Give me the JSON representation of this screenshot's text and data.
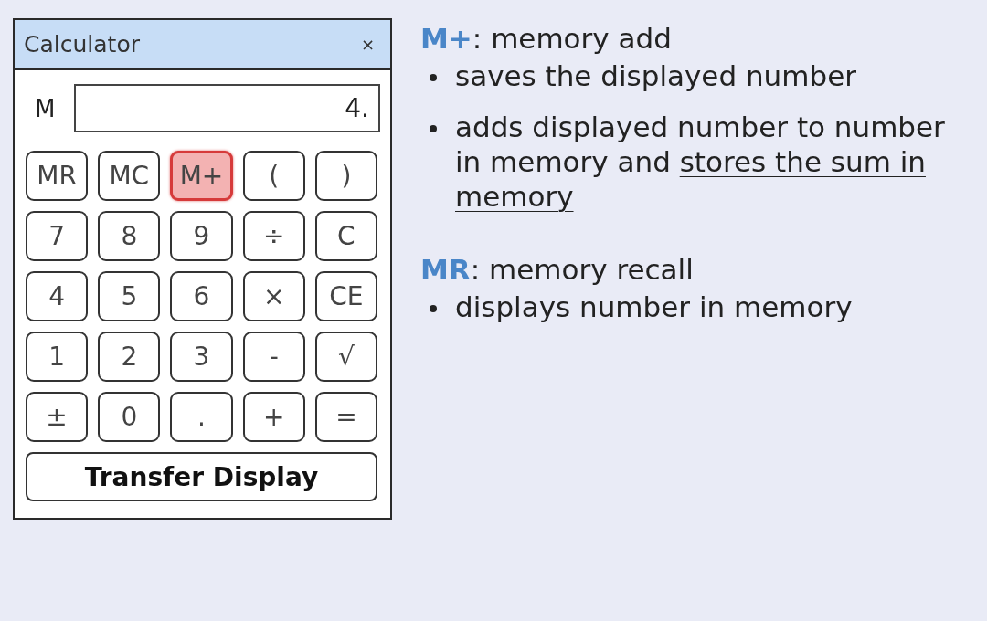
{
  "window": {
    "title": "Calculator",
    "close": "×"
  },
  "memory_indicator": "M",
  "display": {
    "value": "4."
  },
  "keys": [
    {
      "label": "MR",
      "selected": false
    },
    {
      "label": "MC",
      "selected": false
    },
    {
      "label": "M+",
      "selected": true
    },
    {
      "label": "(",
      "selected": false
    },
    {
      "label": ")",
      "selected": false
    },
    {
      "label": "7",
      "selected": false
    },
    {
      "label": "8",
      "selected": false
    },
    {
      "label": "9",
      "selected": false
    },
    {
      "label": "÷",
      "selected": false
    },
    {
      "label": "C",
      "selected": false
    },
    {
      "label": "4",
      "selected": false
    },
    {
      "label": "5",
      "selected": false
    },
    {
      "label": "6",
      "selected": false
    },
    {
      "label": "×",
      "selected": false
    },
    {
      "label": "CE",
      "selected": false
    },
    {
      "label": "1",
      "selected": false
    },
    {
      "label": "2",
      "selected": false
    },
    {
      "label": "3",
      "selected": false
    },
    {
      "label": "-",
      "selected": false
    },
    {
      "label": "√",
      "selected": false
    },
    {
      "label": "±",
      "selected": false
    },
    {
      "label": "0",
      "selected": false
    },
    {
      "label": ".",
      "selected": false
    },
    {
      "label": "+",
      "selected": false
    },
    {
      "label": "=",
      "selected": false
    }
  ],
  "transfer_button": "Transfer Display",
  "notes": [
    {
      "heading": "**M+**: memory add",
      "bullets": [
        {
          "segments": [
            {
              "text": "saves the displayed number",
              "underline": false
            }
          ]
        },
        {
          "segments": [
            {
              "text": "adds displayed number to number in memory and",
              "underline": false
            },
            {
              "text": "stores the sum in memory",
              "underline": true
            }
          ]
        }
      ]
    },
    {
      "heading": "**MR**: memory recall",
      "bullets": [
        {
          "segments": [
            {
              "text": "displays number in memory",
              "underline": false
            }
          ]
        }
      ]
    }
  ]
}
